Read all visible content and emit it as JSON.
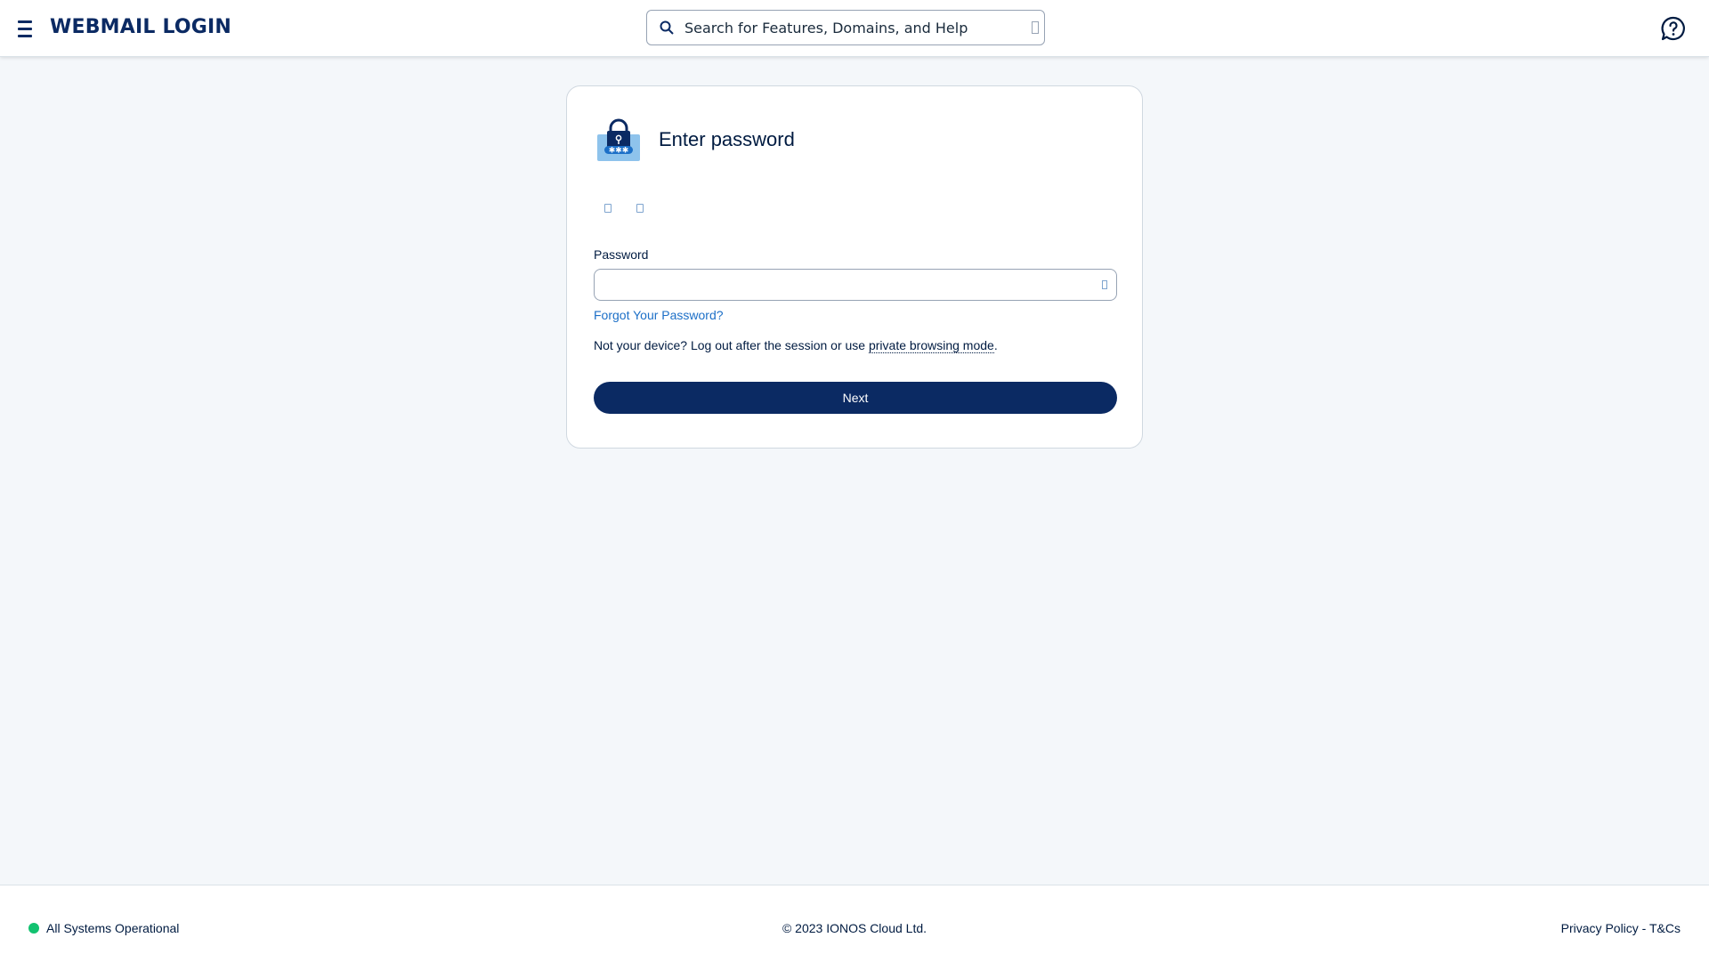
{
  "header": {
    "brand": "WEBMAIL LOGIN",
    "search_placeholder": "Search for Features, Domains, and Help"
  },
  "card": {
    "title": "Enter password",
    "password_label": "Password",
    "forgot_link": "Forgot Your Password?",
    "notice_prefix": "Not your device? Log out after the session or use ",
    "notice_link": "private browsing mode",
    "notice_suffix": ".",
    "next_button": "Next"
  },
  "footer": {
    "status": "All Systems Operational",
    "copyright": "© 2023 IONOS Cloud Ltd.",
    "privacy": "Privacy Policy",
    "separator": " - ",
    "terms": "T&Cs"
  },
  "colors": {
    "brand": "#0b2a63",
    "link": "#1c6fc7",
    "status_ok": "#12c270",
    "background": "#f4f7fa"
  }
}
